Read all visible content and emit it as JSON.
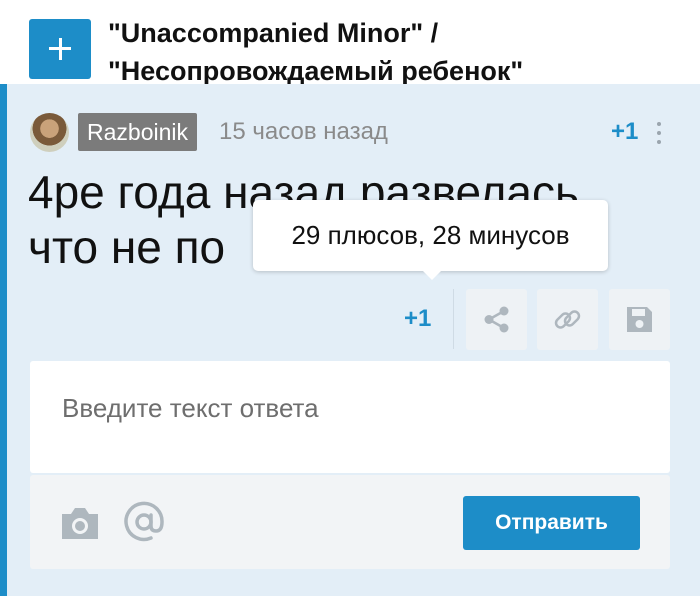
{
  "header": {
    "title_line1": "\"Unaccompanied Minor\" /",
    "title_line2": "\"Несопровождаемый ребенок\""
  },
  "comment": {
    "author": "Razboinik",
    "time": "15 часов назад",
    "rating": "+1",
    "text_line1": "4ре года назад развелась,",
    "text_line2": "что не по"
  },
  "tooltip": {
    "text": "29 плюсов, 28 минусов"
  },
  "actions": {
    "rating": "+1"
  },
  "reply": {
    "placeholder": "Введите текст ответа",
    "send_label": "Отправить"
  },
  "colors": {
    "accent": "#1d8dc8",
    "panel_background": "#e3eef7",
    "username_badge": "#7b7b7b"
  },
  "icons": [
    "plus-icon",
    "more-icon",
    "share-icon",
    "link-icon",
    "save-icon",
    "camera-icon",
    "mention-icon"
  ]
}
